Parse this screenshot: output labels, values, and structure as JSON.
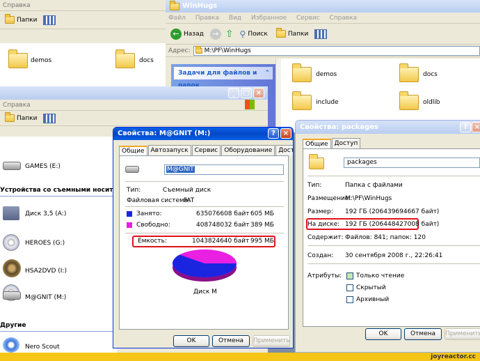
{
  "back_window": {
    "menu_label": "Справка",
    "folders_label": "Папки",
    "items": [
      "demos",
      "docs"
    ]
  },
  "winhugs": {
    "title": "WinHugs",
    "menu": [
      "Файл",
      "Правка",
      "Вид",
      "Избранное",
      "Сервис",
      "Справка"
    ],
    "back_label": "Назад",
    "search_label": "Поиск",
    "folders_label": "Папки",
    "address_label": "Адрес:",
    "address_value": "M:\\PF\\WinHugs",
    "task_header": "Задачи для файлов и папок",
    "folders": [
      "demos",
      "docs",
      "include",
      "oldlib"
    ]
  },
  "mycomputer": {
    "menu_label": "Справка",
    "folders_label": "Папки",
    "drive_games": "GAMES (E:)",
    "removable_header": "Устройства со съемными носителями",
    "drive_floppy": "Диск 3,5 (A:)",
    "drive_heroes": "HEROES (G:)",
    "drive_hsa": "HSA2DVD (I:)",
    "drive_magnit": "M@GNIT (M:)",
    "other_header": "Другие",
    "other_item": "Nero Scout"
  },
  "drive_props": {
    "title": "Свойства: M@GNIT (M:)",
    "tabs": [
      "Общие",
      "Автозапуск",
      "Сервис",
      "Оборудование",
      "Доступ"
    ],
    "name_value": "M@GNIT",
    "type_label": "Тип:",
    "type_value": "Съемный диск",
    "fs_label": "Файловая система:",
    "fs_value": "FAT",
    "used_label": "Занято:",
    "used_bytes": "635076608 байт",
    "used_mb": "605 МБ",
    "free_label": "Свободно:",
    "free_bytes": "408748032 байт",
    "free_mb": "389 МБ",
    "cap_label": "Емкость:",
    "cap_bytes": "1043824640 байт",
    "cap_mb": "995 МБ",
    "disk_label": "Диск M",
    "ok": "OK",
    "cancel": "Отмена",
    "apply": "Применить",
    "used_fraction": 0.608,
    "colors": {
      "used": "#1b25e0",
      "free": "#e91fe2",
      "highlight": "#e0111a"
    }
  },
  "pkg_props": {
    "title": "Свойства: packages",
    "tabs": [
      "Общие",
      "Доступ"
    ],
    "name_value": "packages",
    "type_label": "Тип:",
    "type_value": "Папка с файлами",
    "location_label": "Размещение:",
    "location_value": "M:\\PF\\WinHugs",
    "size_label": "Размер:",
    "size_value": "192 ГБ (206439694667 байт)",
    "ondisk_label": "На диске:",
    "ondisk_value": "192 ГБ (206448427008 байт)",
    "contains_label": "Содержит:",
    "contains_value": "Файлов: 841; папок: 120",
    "created_label": "Создан:",
    "created_value": "30 сентября 2008 г., 22:26:41",
    "attr_label": "Атрибуты:",
    "attr_readonly": "Только чтение",
    "attr_hidden": "Скрытый",
    "attr_archive": "Архивный",
    "ok": "OK",
    "cancel": "Отмена",
    "apply": "Применить"
  },
  "watermark": "joyreactor.cc"
}
